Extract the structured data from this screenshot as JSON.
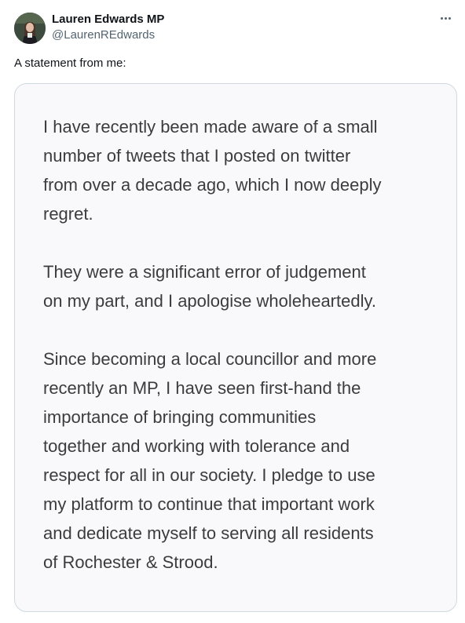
{
  "author": {
    "display_name": "Lauren Edwards MP",
    "handle": "@LaurenREdwards",
    "avatar_icon": "profile-photo"
  },
  "more_icon": "more-options-icon",
  "tweet": {
    "text": "A statement from me:"
  },
  "statement": {
    "paragraphs": [
      {
        "lines": [
          "I have recently been made aware of a small",
          "number of tweets that I posted on twitter",
          "from over a decade ago, which I now deeply",
          "regret."
        ]
      },
      {
        "lines": [
          "They were a significant error of judgement",
          "on my part, and I apologise wholeheartedly."
        ]
      },
      {
        "lines": [
          "Since becoming a local councillor and more",
          "recently an MP, I have seen first-hand the",
          "importance of bringing communities",
          "together and working with tolerance and",
          "respect for all in our society. I pledge to use",
          "my platform to continue that important work",
          "and dedicate myself to serving all residents",
          "of Rochester & Strood."
        ]
      }
    ]
  },
  "colors": {
    "primary_text": "#0f1419",
    "secondary_text": "#536471",
    "card_border": "#cfd9de",
    "card_background": "#f9f9fb",
    "statement_text": "#3c3c3e"
  }
}
